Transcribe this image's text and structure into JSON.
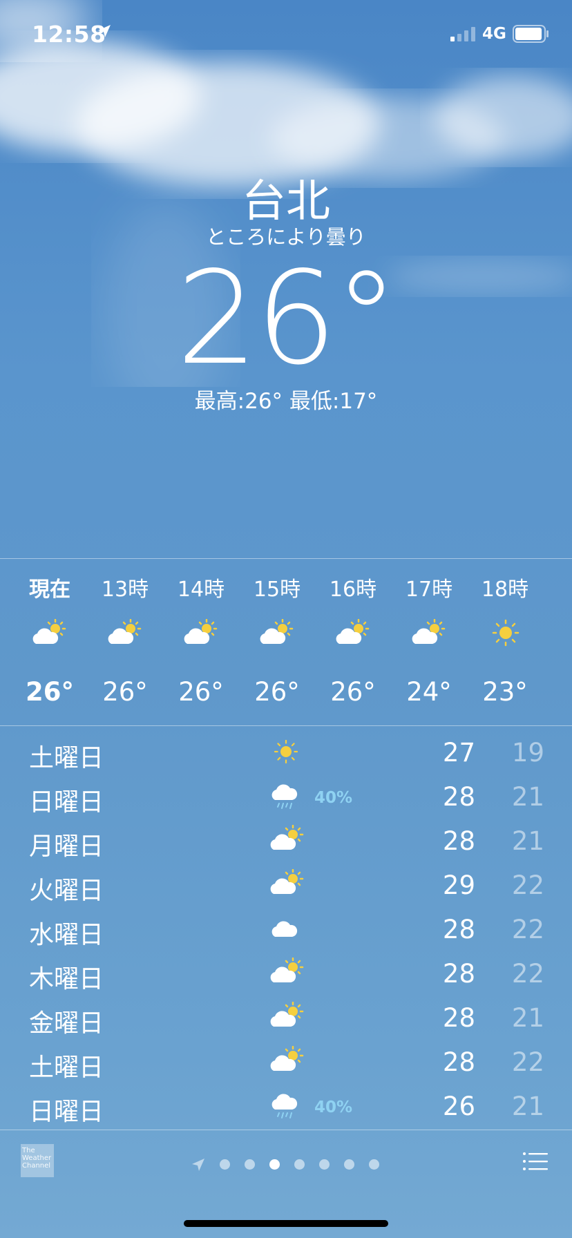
{
  "status_bar": {
    "time": "12:58",
    "network": "4G"
  },
  "header": {
    "city": "台北",
    "condition": "ところにより曇り",
    "temperature": "26°",
    "high_low": "最高:26° 最低:17°"
  },
  "hourly": [
    {
      "label": "現在",
      "icon": "partly-sunny-icon",
      "temp": "26°"
    },
    {
      "label": "13時",
      "icon": "partly-sunny-icon",
      "temp": "26°"
    },
    {
      "label": "14時",
      "icon": "partly-sunny-icon",
      "temp": "26°"
    },
    {
      "label": "15時",
      "icon": "partly-sunny-icon",
      "temp": "26°"
    },
    {
      "label": "16時",
      "icon": "partly-sunny-icon",
      "temp": "26°"
    },
    {
      "label": "17時",
      "icon": "partly-sunny-icon",
      "temp": "24°"
    },
    {
      "label": "18時",
      "icon": "sun-icon",
      "temp": "23°"
    }
  ],
  "daily": [
    {
      "day": "土曜日",
      "icon": "sun-icon",
      "precip": "",
      "high": "27",
      "low": "19"
    },
    {
      "day": "日曜日",
      "icon": "rain-icon",
      "precip": "40%",
      "high": "28",
      "low": "21"
    },
    {
      "day": "月曜日",
      "icon": "partly-sunny-icon",
      "precip": "",
      "high": "28",
      "low": "21"
    },
    {
      "day": "火曜日",
      "icon": "partly-sunny-icon",
      "precip": "",
      "high": "29",
      "low": "22"
    },
    {
      "day": "水曜日",
      "icon": "cloud-icon",
      "precip": "",
      "high": "28",
      "low": "22"
    },
    {
      "day": "木曜日",
      "icon": "partly-sunny-icon",
      "precip": "",
      "high": "28",
      "low": "22"
    },
    {
      "day": "金曜日",
      "icon": "partly-sunny-icon",
      "precip": "",
      "high": "28",
      "low": "21"
    },
    {
      "day": "土曜日",
      "icon": "partly-sunny-icon",
      "precip": "",
      "high": "28",
      "low": "22"
    },
    {
      "day": "日曜日",
      "icon": "rain-icon",
      "precip": "40%",
      "high": "26",
      "low": "21"
    }
  ],
  "footer": {
    "brand": "The Weather Channel",
    "page_count": 7,
    "active_page": 3
  },
  "colors": {
    "sun": "#f5cf3f",
    "precip": "#8fd2f2"
  }
}
